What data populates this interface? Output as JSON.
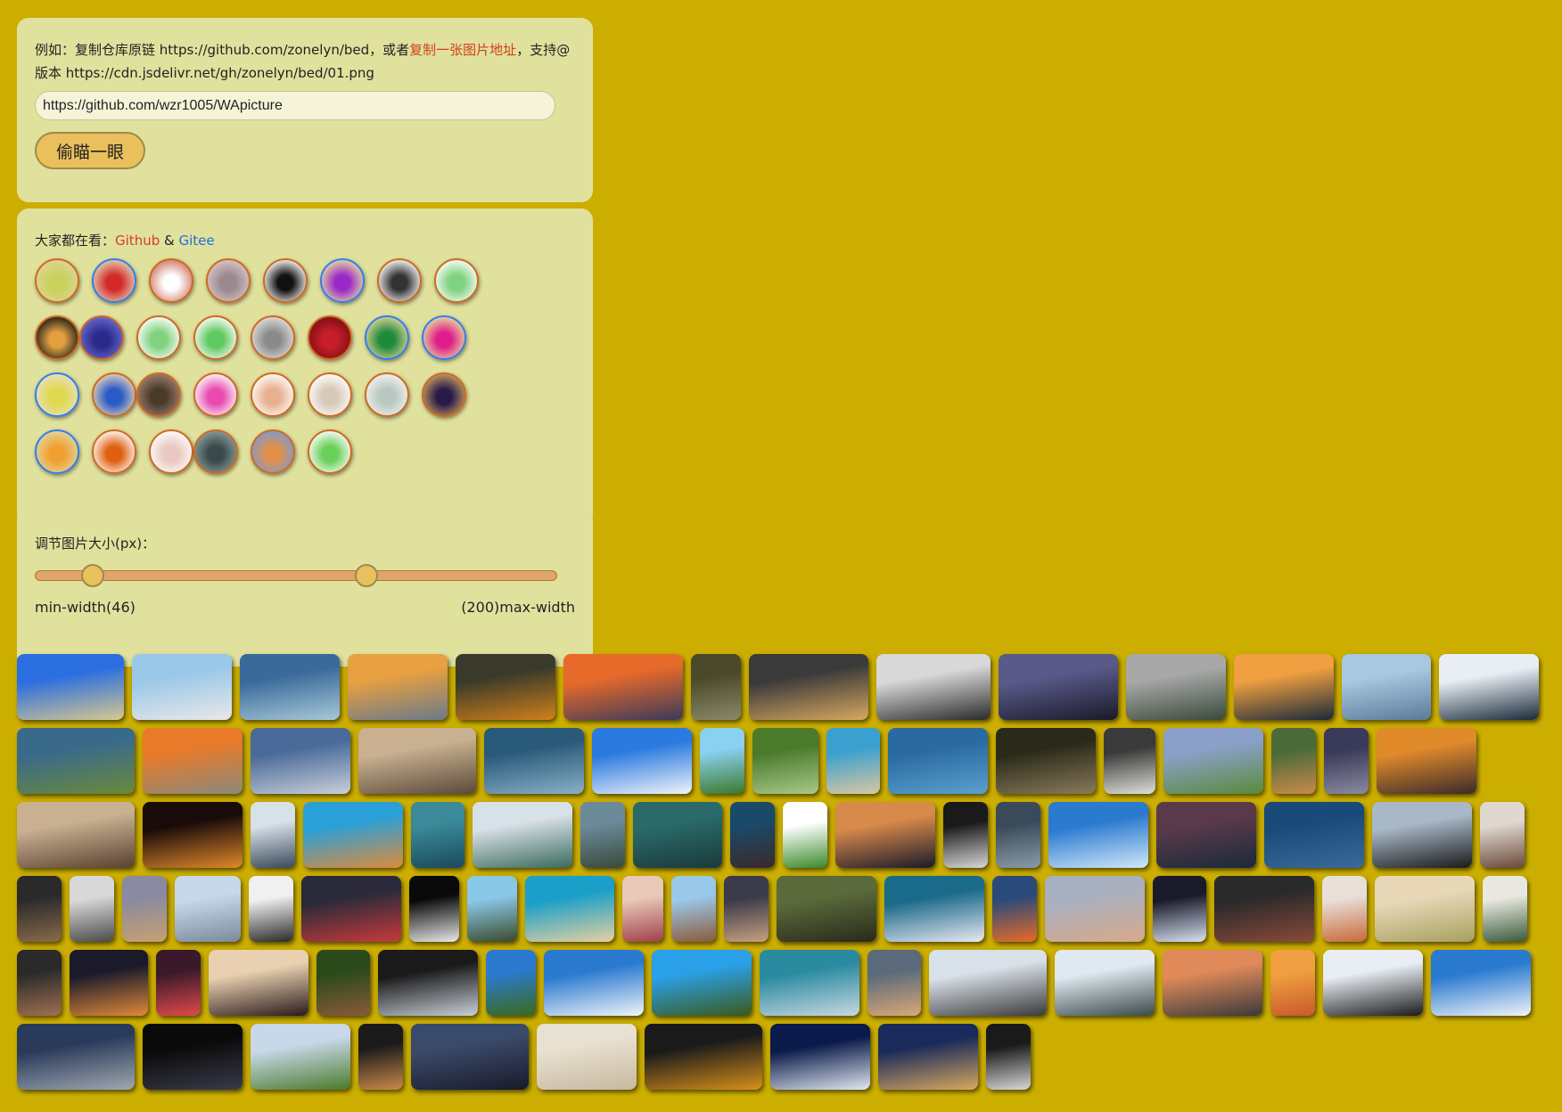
{
  "url_panel": {
    "hint_prefix": "例如：复制仓库原链 https://github.com/zonelyn/bed，或者",
    "hint_link": "复制一张图片地址",
    "hint_suffix": "，支持@版本 https://cdn.jsdelivr.net/gh/zonelyn/bed/01.png",
    "input_value": "https://github.com/wzr1005/WApicture",
    "button_label": "偷瞄一眼"
  },
  "avatars_panel": {
    "prefix": "大家都在看：",
    "github_label": "Github",
    "and": " & ",
    "gitee_label": "Gitee",
    "avatars": [
      {
        "c1": "#c8d25a",
        "c2": "#e0d39b",
        "source": "github"
      },
      {
        "c1": "#d42a2a",
        "c2": "#e2d6b8",
        "source": "gitee"
      },
      {
        "c1": "#ffffff",
        "c2": "#d07a6a",
        "source": "github"
      },
      {
        "c1": "#9a8a90",
        "c2": "#d8c8c8",
        "source": "github"
      },
      {
        "c1": "#111111",
        "c2": "#ffffff",
        "source": "github"
      },
      {
        "c1": "#9a2ac8",
        "c2": "#e8e0a0",
        "source": "gitee"
      },
      {
        "c1": "#333333",
        "c2": "#ffffff",
        "source": "github"
      },
      {
        "c1": "#7fd27f",
        "c2": "#ffffff",
        "source": "github"
      },
      {
        "c1": "#e2a040",
        "c2": "#1a1a1a",
        "source": "github"
      },
      {
        "c1": "#2a2a8a",
        "c2": "#6a6ad2",
        "source": "github"
      },
      {
        "c1": "#7fd27f",
        "c2": "#ffffff",
        "source": "github"
      },
      {
        "c1": "#5fc85f",
        "c2": "#ffffff",
        "source": "github"
      },
      {
        "c1": "#8a8a8a",
        "c2": "#e0e0e0",
        "source": "github"
      },
      {
        "c1": "#c81e2a",
        "c2": "#7a0e14",
        "source": "github"
      },
      {
        "c1": "#1e8a3a",
        "c2": "#e0d49b",
        "source": "gitee"
      },
      {
        "c1": "#e01e8a",
        "c2": "#e8e0a0",
        "source": "gitee"
      },
      {
        "c1": "#e0d850",
        "c2": "#e8e0c0",
        "source": "gitee"
      },
      {
        "c1": "#2a5ac8",
        "c2": "#e8d4b8",
        "source": "github"
      },
      {
        "c1": "#4a3a2a",
        "c2": "#a08070",
        "source": "github"
      },
      {
        "c1": "#e84ab0",
        "c2": "#ffffff",
        "source": "github"
      },
      {
        "c1": "#e8b090",
        "c2": "#ffffff",
        "source": "github"
      },
      {
        "c1": "#d8c8b8",
        "c2": "#ffffff",
        "source": "github"
      },
      {
        "c1": "#b8c8c0",
        "c2": "#f2f2f2",
        "source": "github"
      },
      {
        "c1": "#2a1a4a",
        "c2": "#c8a060",
        "source": "github"
      },
      {
        "c1": "#f0a030",
        "c2": "#e0d8a0",
        "source": "gitee"
      },
      {
        "c1": "#e06010",
        "c2": "#ffffff",
        "source": "github"
      },
      {
        "c1": "#e8c8c0",
        "c2": "#ffffff",
        "source": "github"
      },
      {
        "c1": "#3a4a4a",
        "c2": "#8aa0a0",
        "source": "github"
      },
      {
        "c1": "#e0904a",
        "c2": "#7a9ad8",
        "source": "github"
      },
      {
        "c1": "#6ad05a",
        "c2": "#ffffff",
        "source": "github"
      }
    ]
  },
  "slider_panel": {
    "label": "调节图片大小(px)：",
    "min_label": "min-width(46)",
    "max_label": "(200)max-width",
    "low_fraction": 0.11,
    "high_fraction": 0.636
  },
  "gallery": {
    "rows": [
      [
        {
          "w": 120,
          "c1": "#2a6ee0",
          "c2": "#d8c890"
        },
        {
          "w": 112,
          "c1": "#9ac8e8",
          "c2": "#e8e8e8"
        },
        {
          "w": 112,
          "c1": "#3a6a9a",
          "c2": "#a8c8d8"
        },
        {
          "w": 112,
          "c1": "#e8a040",
          "c2": "#6a7a8a"
        },
        {
          "w": 112,
          "c1": "#3a3a2a",
          "c2": "#d0801a"
        },
        {
          "w": 134,
          "c1": "#e86a2a",
          "c2": "#3a3a5a"
        },
        {
          "w": 56,
          "c1": "#4a4a2a",
          "c2": "#8a8a6a"
        },
        {
          "w": 134,
          "c1": "#3a3a3a",
          "c2": "#d8a860"
        },
        {
          "w": 128,
          "c1": "#d8d8d8",
          "c2": "#2a2a2a"
        },
        {
          "w": 134,
          "c1": "#5a5a8a",
          "c2": "#1a1a2a"
        },
        {
          "w": 112,
          "c1": "#a8a8a8",
          "c2": "#3a4a3a"
        },
        {
          "w": 112,
          "c1": "#f0a040",
          "c2": "#1a2a3a"
        },
        {
          "w": 100,
          "c1": "#a8c8e0",
          "c2": "#5a7a9a"
        },
        {
          "w": 112,
          "c1": "#e8eef4",
          "c2": "#1a2a3a"
        }
      ],
      [
        {
          "w": 132,
          "c1": "#3a6a8a",
          "c2": "#6a8a3a"
        },
        {
          "w": 112,
          "c1": "#e87a2a",
          "c2": "#8a8a7a"
        },
        {
          "w": 112,
          "c1": "#4a6a9a",
          "c2": "#c8d0d8"
        },
        {
          "w": 132,
          "c1": "#c8b090",
          "c2": "#5a4a3a"
        },
        {
          "w": 112,
          "c1": "#2a5a7a",
          "c2": "#8ab0c8"
        },
        {
          "w": 112,
          "c1": "#2a7ae0",
          "c2": "#f0f4f8"
        },
        {
          "w": 50,
          "c1": "#8ad0f0",
          "c2": "#3a7a2a"
        },
        {
          "w": 74,
          "c1": "#4a7a2a",
          "c2": "#a8c88a"
        },
        {
          "w": 60,
          "c1": "#3aa0d0",
          "c2": "#d8c8a0"
        },
        {
          "w": 112,
          "c1": "#2a6aa0",
          "c2": "#5aa0d0"
        },
        {
          "w": 112,
          "c1": "#2a2a1a",
          "c2": "#8a7a5a"
        },
        {
          "w": 58,
          "c1": "#3a3a3a",
          "c2": "#e0e0d8"
        },
        {
          "w": 112,
          "c1": "#8aa0c8",
          "c2": "#5a8a3a"
        },
        {
          "w": 50,
          "c1": "#4a6a3a",
          "c2": "#c88a4a"
        },
        {
          "w": 50,
          "c1": "#3a3a5a",
          "c2": "#8a8aa0"
        },
        {
          "w": 112,
          "c1": "#e08a2a",
          "c2": "#3a2a2a"
        }
      ],
      [
        {
          "w": 132,
          "c1": "#c8b090",
          "c2": "#5a4030"
        },
        {
          "w": 112,
          "c1": "#1a0a0a",
          "c2": "#e08a2a"
        },
        {
          "w": 50,
          "c1": "#d8e0e8",
          "c2": "#3a4a5a"
        },
        {
          "w": 112,
          "c1": "#2aa0d8",
          "c2": "#e08a3a"
        },
        {
          "w": 60,
          "c1": "#3a8a9a",
          "c2": "#1a4a5a"
        },
        {
          "w": 112,
          "c1": "#d8e0e8",
          "c2": "#3a6a5a"
        },
        {
          "w": 50,
          "c1": "#6a8a9a",
          "c2": "#3a4a3a"
        },
        {
          "w": 100,
          "c1": "#2a6a6a",
          "c2": "#1a3a3a"
        },
        {
          "w": 50,
          "c1": "#1a4a6a",
          "c2": "#3a2a2a"
        },
        {
          "w": 50,
          "c1": "#ffffff",
          "c2": "#3a8a2a"
        },
        {
          "w": 112,
          "c1": "#d88a4a",
          "c2": "#1a1a2a"
        },
        {
          "w": 50,
          "c1": "#1a1a1a",
          "c2": "#d8d8d8"
        },
        {
          "w": 50,
          "c1": "#3a4a5a",
          "c2": "#8a9aa8"
        },
        {
          "w": 112,
          "c1": "#2a7ad0",
          "c2": "#d0e8f8"
        },
        {
          "w": 112,
          "c1": "#5a3a4a",
          "c2": "#1a2a3a"
        },
        {
          "w": 112,
          "c1": "#1a4a7a",
          "c2": "#3a6a9a"
        },
        {
          "w": 112,
          "c1": "#a8b8c8",
          "c2": "#1a1a1a"
        },
        {
          "w": 50,
          "c1": "#e0d8d0",
          "c2": "#6a4a3a"
        }
      ],
      [
        {
          "w": 50,
          "c1": "#2a2a2a",
          "c2": "#8a6a4a"
        },
        {
          "w": 50,
          "c1": "#d8d8d8",
          "c2": "#4a4a4a"
        },
        {
          "w": 50,
          "c1": "#8a8aa0",
          "c2": "#c8a070"
        },
        {
          "w": 74,
          "c1": "#c8d8e8",
          "c2": "#7a8a9a"
        },
        {
          "w": 50,
          "c1": "#f0f0f0",
          "c2": "#2a2a2a"
        },
        {
          "w": 112,
          "c1": "#2a2a3a",
          "c2": "#c83a3a"
        },
        {
          "w": 56,
          "c1": "#0a0a0a",
          "c2": "#e8e8e8"
        },
        {
          "w": 56,
          "c1": "#8ac8e8",
          "c2": "#3a4a2a"
        },
        {
          "w": 100,
          "c1": "#1aa0c8",
          "c2": "#e8d0a0"
        },
        {
          "w": 46,
          "c1": "#e8c8b8",
          "c2": "#a0404a"
        },
        {
          "w": 50,
          "c1": "#9ac8e8",
          "c2": "#8a5a3a"
        },
        {
          "w": 50,
          "c1": "#3a3a4a",
          "c2": "#c8a080"
        },
        {
          "w": 112,
          "c1": "#5a6a3a",
          "c2": "#2a2a1a"
        },
        {
          "w": 112,
          "c1": "#1a6a8a",
          "c2": "#e8e8f0"
        },
        {
          "w": 50,
          "c1": "#2a4a7a",
          "c2": "#e86a2a"
        },
        {
          "w": 112,
          "c1": "#a8b0c0",
          "c2": "#d8a888"
        },
        {
          "w": 60,
          "c1": "#1a1a2a",
          "c2": "#d8e0f0"
        },
        {
          "w": 112,
          "c1": "#2a2a2a",
          "c2": "#8a4a3a"
        },
        {
          "w": 50,
          "c1": "#e8e0d8",
          "c2": "#c86a3a"
        },
        {
          "w": 112,
          "c1": "#e8d8b8",
          "c2": "#a8a060"
        },
        {
          "w": 50,
          "c1": "#e8e8e0",
          "c2": "#3a5a3a"
        }
      ],
      [
        {
          "w": 50,
          "c1": "#2a2a2a",
          "c2": "#a07050"
        },
        {
          "w": 88,
          "c1": "#1a1a2a",
          "c2": "#e08a3a"
        },
        {
          "w": 50,
          "c1": "#3a1a2a",
          "c2": "#e04a4a"
        },
        {
          "w": 112,
          "c1": "#e8d0b0",
          "c2": "#2a1a1a"
        },
        {
          "w": 60,
          "c1": "#2a4a1a",
          "c2": "#8a5a3a"
        },
        {
          "w": 112,
          "c1": "#1a1a1a",
          "c2": "#c8d0d8"
        },
        {
          "w": 56,
          "c1": "#2a7ad0",
          "c2": "#3a6a1a"
        },
        {
          "w": 112,
          "c1": "#2a7ad0",
          "c2": "#f0f4f8"
        },
        {
          "w": 112,
          "c1": "#2aa0e8",
          "c2": "#3a5a1a"
        },
        {
          "w": 112,
          "c1": "#2a8aa0",
          "c2": "#c8d8e0"
        },
        {
          "w": 60,
          "c1": "#5a6a7a",
          "c2": "#d8a878"
        },
        {
          "w": 132,
          "c1": "#d8e0e8",
          "c2": "#3a3a3a"
        },
        {
          "w": 112,
          "c1": "#e0e8f0",
          "c2": "#3a4a4a"
        },
        {
          "w": 112,
          "c1": "#e08a5a",
          "c2": "#3a3a3a"
        },
        {
          "w": 50,
          "c1": "#f0a040",
          "c2": "#c85a2a"
        },
        {
          "w": 112,
          "c1": "#e8eef4",
          "c2": "#1a1a1a"
        },
        {
          "w": 112,
          "c1": "#2a7ad0",
          "c2": "#f0f4f8"
        }
      ],
      [
        {
          "w": 132,
          "c1": "#2a3a5a",
          "c2": "#a0a8b0"
        },
        {
          "w": 112,
          "c1": "#0a0a0a",
          "c2": "#3a3a4a"
        },
        {
          "w": 112,
          "c1": "#c8d8e8",
          "c2": "#4a7a2a"
        },
        {
          "w": 50,
          "c1": "#1a1a1a",
          "c2": "#c88a4a"
        },
        {
          "w": 132,
          "c1": "#3a4a6a",
          "c2": "#1a1a2a"
        },
        {
          "w": 112,
          "c1": "#e8e0d0",
          "c2": "#c8b8a0"
        },
        {
          "w": 132,
          "c1": "#1a1a1a",
          "c2": "#d8901a"
        },
        {
          "w": 112,
          "c1": "#0a1a4a",
          "c2": "#e0e8f0"
        },
        {
          "w": 112,
          "c1": "#1a2a5a",
          "c2": "#d8a860"
        },
        {
          "w": 50,
          "c1": "#1a1a1a",
          "c2": "#d8d8d8"
        }
      ]
    ]
  }
}
